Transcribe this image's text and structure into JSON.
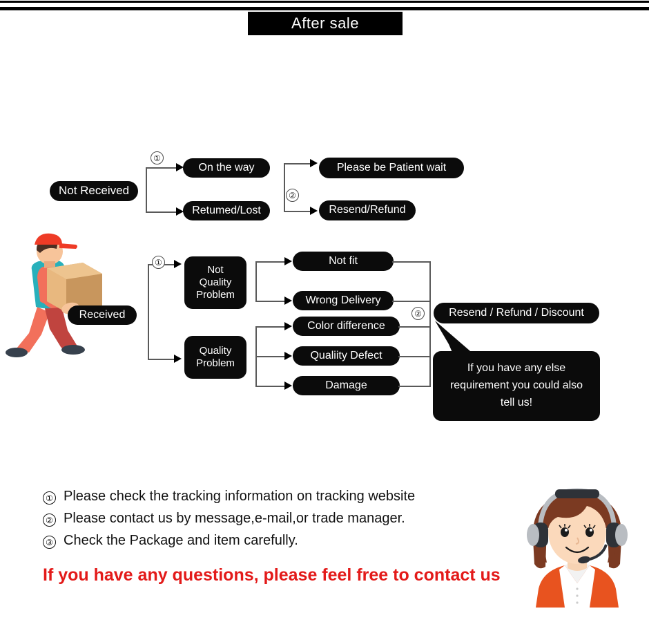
{
  "header": {
    "title": "After sale"
  },
  "flow_not_received": {
    "root": {
      "label": "Not Received"
    },
    "branch_marker": "①",
    "stage1": [
      {
        "label": "On the way"
      },
      {
        "label": "Retumed/Lost"
      }
    ],
    "stage2_marker": "②",
    "stage2": [
      {
        "label": "Please be Patient wait"
      },
      {
        "label": "Resend/Refund"
      }
    ]
  },
  "flow_received": {
    "root": {
      "label": "Received"
    },
    "branch_marker": "①",
    "categories": [
      {
        "label": "Not\nQuality\nProblem"
      },
      {
        "label": "Quality\nProblem"
      }
    ],
    "not_quality_issues": [
      {
        "label": "Not fit"
      },
      {
        "label": "Wrong Delivery"
      }
    ],
    "quality_issues": [
      {
        "label": "Color difference"
      },
      {
        "label": "Qualiity Defect"
      },
      {
        "label": "Damage"
      }
    ],
    "resolution_marker": "②",
    "resolution": {
      "label": "Resend / Refund / Discount"
    },
    "callout": {
      "text": "If you have any else requirement you could also tell us!"
    }
  },
  "notes": [
    {
      "marker": "①",
      "text": "Please check the tracking information on tracking website"
    },
    {
      "marker": "②",
      "text": "Please contact us by message,e-mail,or trade manager."
    },
    {
      "marker": "③",
      "text": "Check the Package and item carefully."
    }
  ],
  "footer": {
    "cta": "If you have any questions, please feel free to contact us"
  },
  "illustrations": {
    "courier": "delivery-courier-carrying-box-illustration",
    "agent": "customer-service-agent-headset-illustration"
  },
  "colors": {
    "node_bg": "#0b0b0b",
    "node_text": "#ffffff",
    "connector": "#595959",
    "cta_red": "#e31a19",
    "page_bg": "#ffffff"
  }
}
